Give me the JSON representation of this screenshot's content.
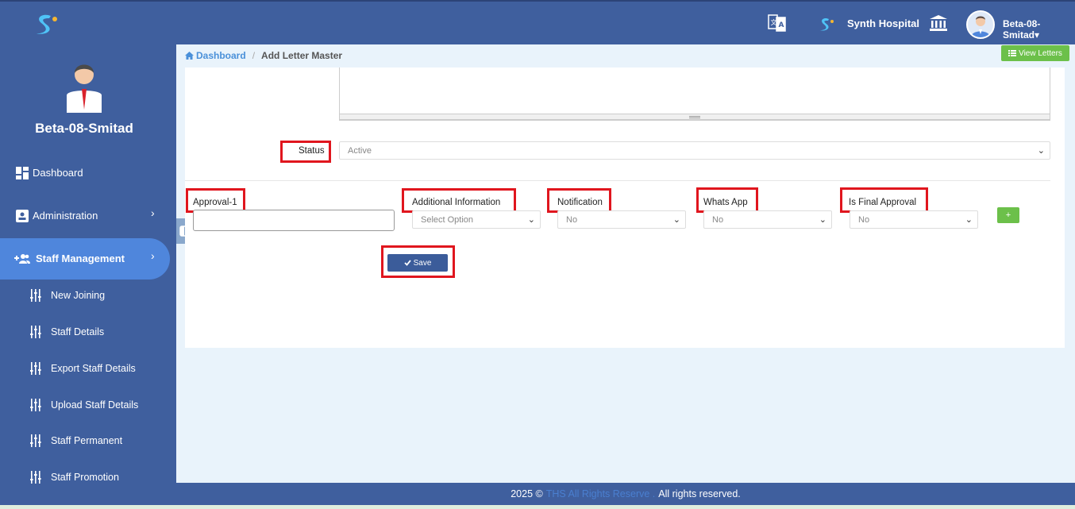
{
  "topbar": {
    "hospital_name": "Synth Hospital",
    "user_name": "Beta-08-Smitad",
    "caret": "▾"
  },
  "sidebar": {
    "profile_name": "Beta-08-Smitad",
    "items": [
      {
        "label": "Dashboard"
      },
      {
        "label": "Administration",
        "chevron": "›"
      },
      {
        "label": "Staff Management",
        "chevron": "›"
      }
    ],
    "sub_items": [
      {
        "label": "New Joining"
      },
      {
        "label": "Staff Details"
      },
      {
        "label": "Export Staff Details"
      },
      {
        "label": "Upload Staff Details"
      },
      {
        "label": "Staff Permanent"
      },
      {
        "label": "Staff Promotion"
      }
    ]
  },
  "breadcrumb": {
    "home": "Dashboard",
    "separator": "/",
    "current": "Add Letter Master"
  },
  "view_letters_label": "View Letters",
  "form": {
    "status_label": "Status",
    "status_value": "Active",
    "approval_label": "Approval-1",
    "approval_value": "",
    "additional_info_label": "Additional Information",
    "additional_info_value": "Select Option",
    "notification_label": "Notification",
    "notification_value": "No",
    "whatsapp_label": "Whats App",
    "whatsapp_value": "No",
    "final_approval_label": "Is Final Approval",
    "final_approval_value": "No",
    "plus_label": "+",
    "save_label": "Save"
  },
  "footer": {
    "prefix": "2025 ©",
    "brand": "THS All Rights Reserve .",
    "suffix": "All rights reserved."
  },
  "colors": {
    "primary": "#3f5f9e",
    "active_nav": "#4f86dc",
    "success": "#6cc04a",
    "highlight": "#e0161e"
  }
}
